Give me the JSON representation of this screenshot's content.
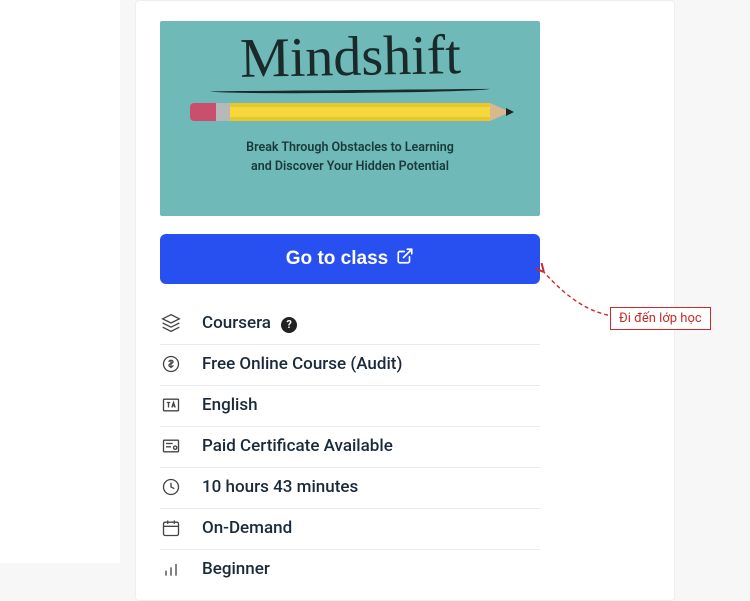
{
  "banner": {
    "title": "Mindshift",
    "subtitle_line1": "Break Through Obstacles to Learning",
    "subtitle_line2": "and Discover Your Hidden Potential"
  },
  "cta": {
    "label": "Go to class"
  },
  "details": {
    "provider": "Coursera",
    "pricing": "Free Online Course (Audit)",
    "language": "English",
    "certificate": "Paid Certificate Available",
    "duration": "10 hours 43 minutes",
    "availability": "On-Demand",
    "level": "Beginner"
  },
  "annotation": {
    "text": "Đi đến lớp học"
  }
}
